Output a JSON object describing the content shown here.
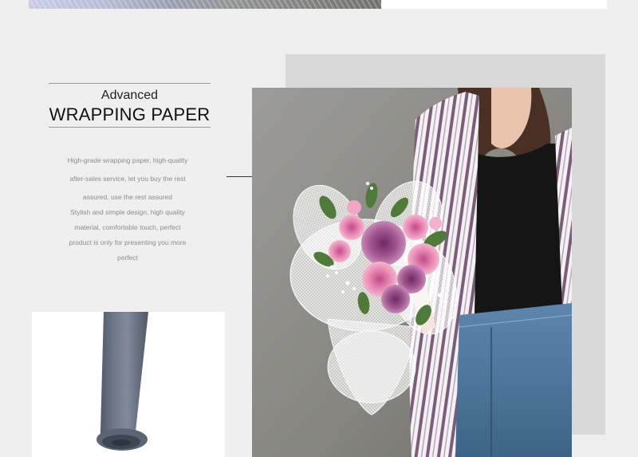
{
  "header": {
    "title_small": "Advanced",
    "title_big": "WRAPPING PAPER"
  },
  "description": {
    "lines": [
      "High-grade wrapping paper, high-quality",
      "after-sales service, let you buy the rest",
      "assured, use the rest assured",
      "Stylish and simple design, high quality",
      "material, comfortable touch, perfect",
      "product is only for presenting you more",
      "perfect"
    ]
  },
  "colors": {
    "background": "#efefef",
    "backdrop": "#d9d9d9",
    "text_dark": "#111111",
    "text_muted": "#8c8c8c",
    "roll": "#5f6b78"
  },
  "images": {
    "main_photo": "woman-holding-flower-bouquet",
    "product": "wrapping-paper-roll"
  }
}
